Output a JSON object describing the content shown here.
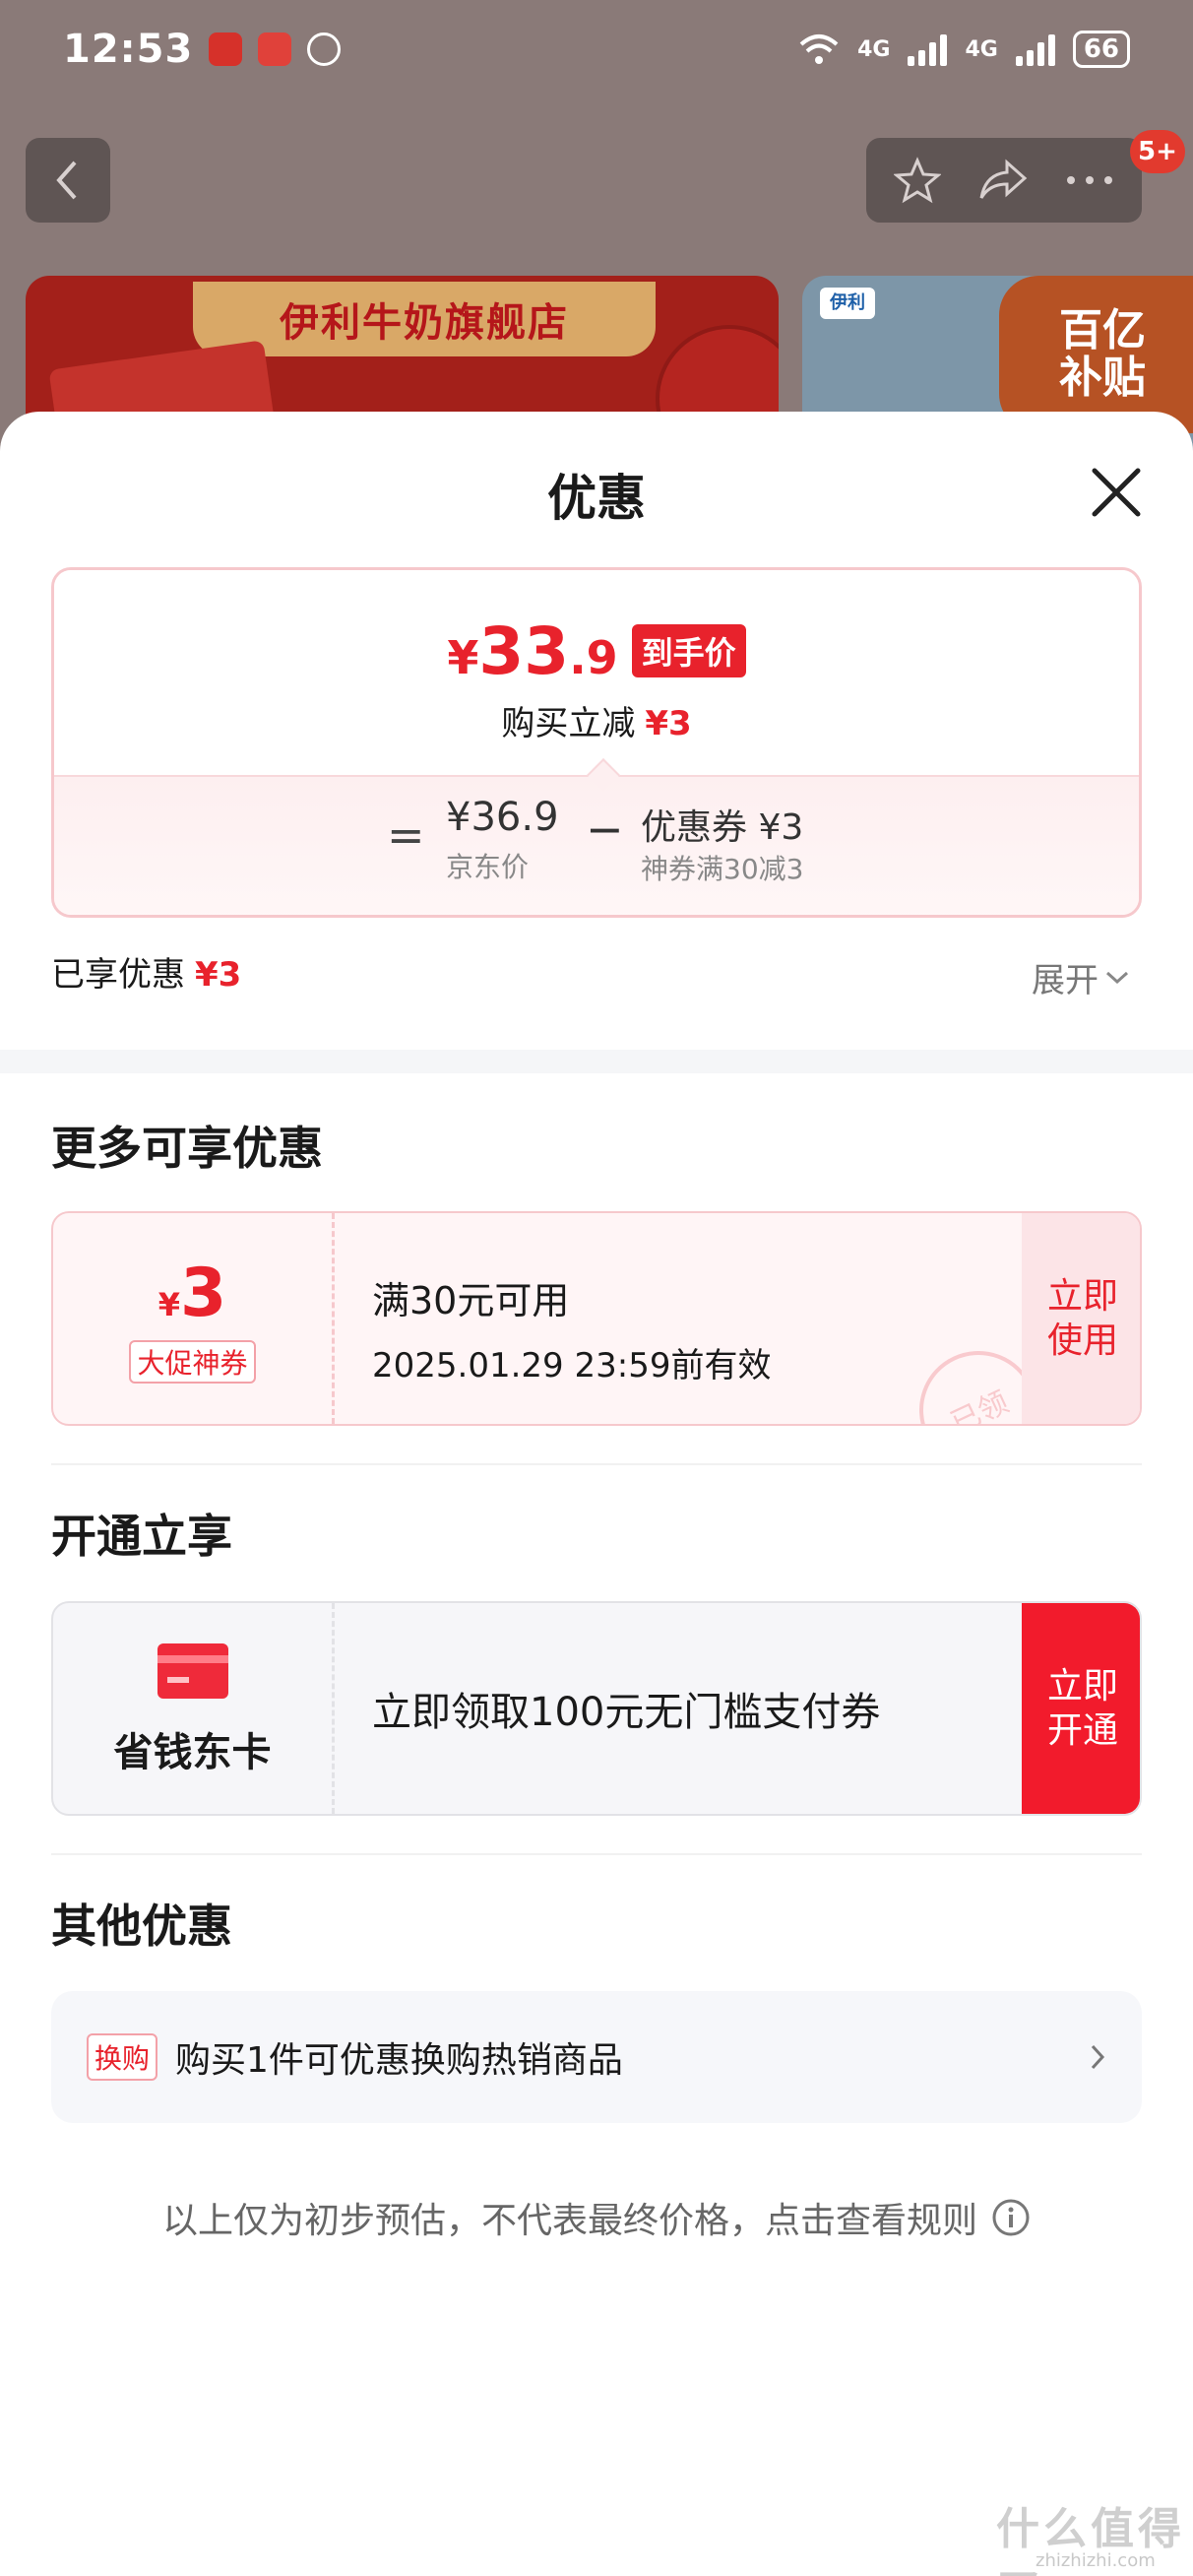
{
  "status_bar": {
    "time": "12:53",
    "network_1": "4G",
    "network_2": "4G",
    "battery": "66"
  },
  "nav": {
    "badge": "5+"
  },
  "background": {
    "store_banner": "伊利牛奶旗舰店",
    "banner_logo": "伊利",
    "subsidy_banner": [
      "百亿",
      "补贴"
    ]
  },
  "sheet": {
    "title": "优惠",
    "price_card": {
      "currency": "¥",
      "final_price_int": "33",
      "final_price_dec": ".9",
      "final_tag": "到手价",
      "instant_label": "购买立减",
      "instant_amount": "¥3",
      "eq": "=",
      "jd_price": "¥36.9",
      "jd_label": "京东价",
      "minus": "−",
      "coupon_label": "优惠券 ¥3",
      "coupon_desc": "神券满30减3"
    },
    "enjoyed_label": "已享优惠",
    "enjoyed_amount": "¥3",
    "expand_label": "展开",
    "more_title": "更多可享优惠",
    "coupon": {
      "currency": "¥",
      "amount": "3",
      "tag": "大促神券",
      "condition": "满30元可用",
      "validity": "2025.01.29 23:59前有效",
      "action": "立即使用",
      "stamp": "已领"
    },
    "open_title": "开通立享",
    "vip_card": {
      "name": "省钱东卡",
      "desc": "立即领取100元无门槛支付券",
      "action": "立即开通"
    },
    "other_title": "其他优惠",
    "other_item": {
      "tag": "换购",
      "text": "购买1件可优惠换购热销商品"
    },
    "disclaimer": "以上仅为初步预估，不代表最终价格，点击查看规则"
  },
  "watermark": {
    "main": "什么值得买",
    "sub": "zhizhizhi.com"
  },
  "colors": {
    "accent": "#e8222c",
    "pink_border": "#f6c8cc",
    "overlay": "#8a7a78"
  }
}
